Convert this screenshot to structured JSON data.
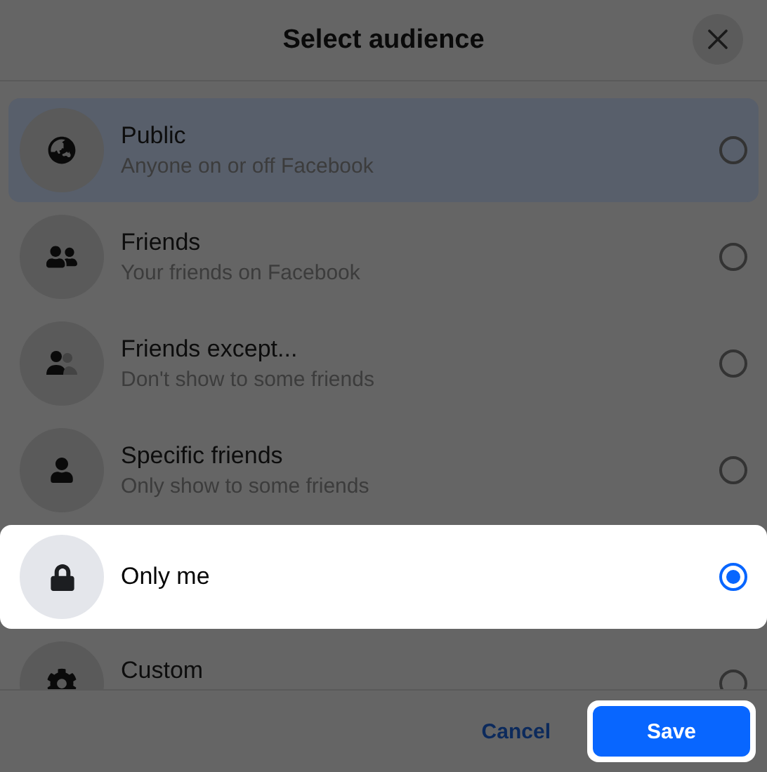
{
  "dialog": {
    "title": "Select audience"
  },
  "options": [
    {
      "kind": "globe",
      "title": "Public",
      "subtitle": "Anyone on or off Facebook",
      "selected": false,
      "hovered": true,
      "highlighted": false
    },
    {
      "kind": "group",
      "title": "Friends",
      "subtitle": "Your friends on Facebook",
      "selected": false,
      "hovered": false,
      "highlighted": false
    },
    {
      "kind": "except",
      "title": "Friends except...",
      "subtitle": "Don't show to some friends",
      "selected": false,
      "hovered": false,
      "highlighted": false
    },
    {
      "kind": "person",
      "title": "Specific friends",
      "subtitle": "Only show to some friends",
      "selected": false,
      "hovered": false,
      "highlighted": false
    },
    {
      "kind": "lock",
      "title": "Only me",
      "selected": true,
      "hovered": false,
      "highlighted": true
    },
    {
      "kind": "gear",
      "title": "Custom",
      "selected": false,
      "hovered": false,
      "highlighted": false
    }
  ],
  "footer": {
    "cancel": {
      "label": "Cancel",
      "highlighted": false
    },
    "save": {
      "label": "Save",
      "highlighted": true
    }
  }
}
